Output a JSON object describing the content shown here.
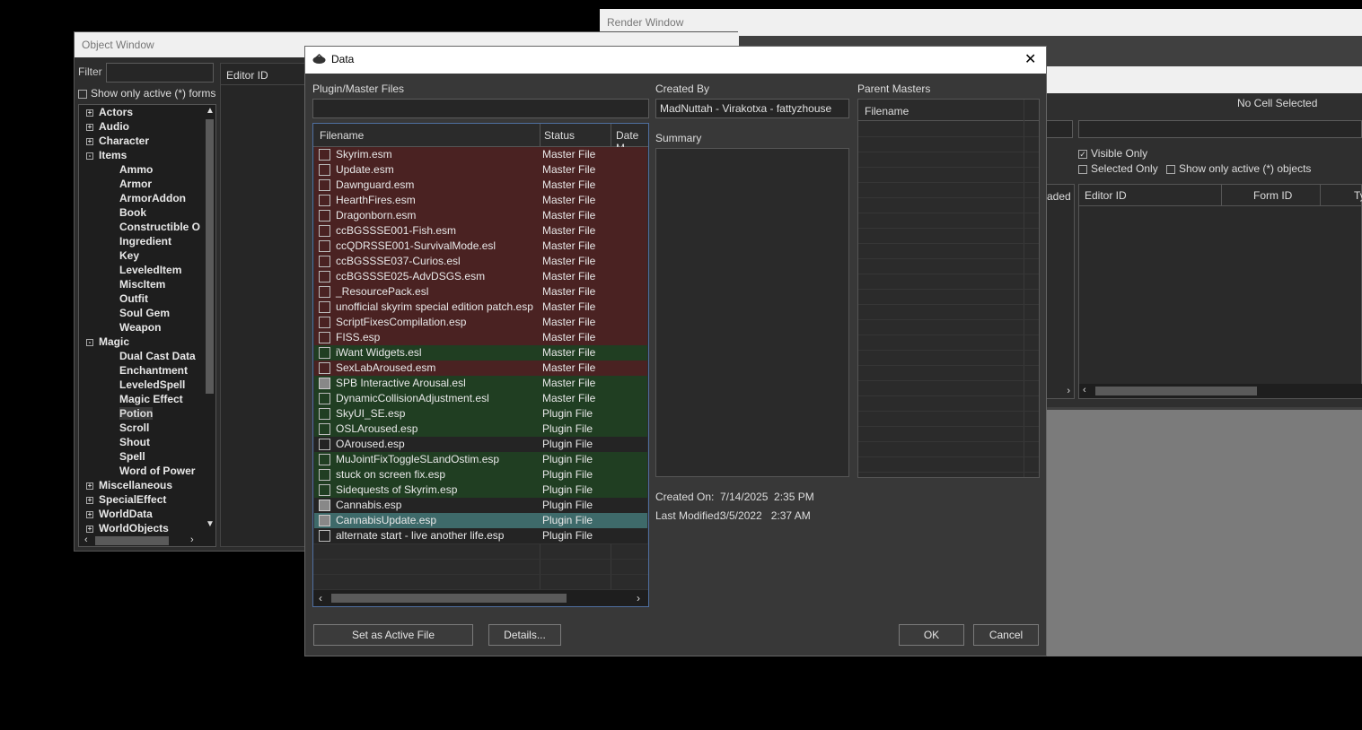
{
  "render_window": {
    "title": "Render Window",
    "no_cell": "No Cell Selected",
    "visible_only": "Visible Only",
    "selected_only": "Selected Only",
    "show_active_objects": "Show only active (*) objects",
    "col_loaded": "aded",
    "col_editor_id": "Editor ID",
    "col_form_id": "Form ID",
    "col_type": "Ty"
  },
  "object_window": {
    "title": "Object Window",
    "filter_label": "Filter",
    "show_active_forms": "Show only active (*) forms",
    "editor_id_col": "Editor ID",
    "tree": [
      {
        "label": "Actors",
        "level": 0,
        "exp": "+"
      },
      {
        "label": "Audio",
        "level": 0,
        "exp": "+"
      },
      {
        "label": "Character",
        "level": 0,
        "exp": "+"
      },
      {
        "label": "Items",
        "level": 0,
        "exp": "-"
      },
      {
        "label": "Ammo",
        "level": 1
      },
      {
        "label": "Armor",
        "level": 1
      },
      {
        "label": "ArmorAddon",
        "level": 1
      },
      {
        "label": "Book",
        "level": 1
      },
      {
        "label": "Constructible O",
        "level": 1
      },
      {
        "label": "Ingredient",
        "level": 1
      },
      {
        "label": "Key",
        "level": 1
      },
      {
        "label": "LeveledItem",
        "level": 1
      },
      {
        "label": "MiscItem",
        "level": 1
      },
      {
        "label": "Outfit",
        "level": 1
      },
      {
        "label": "Soul Gem",
        "level": 1
      },
      {
        "label": "Weapon",
        "level": 1
      },
      {
        "label": "Magic",
        "level": 0,
        "exp": "-"
      },
      {
        "label": "Dual Cast Data",
        "level": 1
      },
      {
        "label": "Enchantment",
        "level": 1
      },
      {
        "label": "LeveledSpell",
        "level": 1
      },
      {
        "label": "Magic Effect",
        "level": 1
      },
      {
        "label": "Potion",
        "level": 1,
        "selected": true
      },
      {
        "label": "Scroll",
        "level": 1
      },
      {
        "label": "Shout",
        "level": 1
      },
      {
        "label": "Spell",
        "level": 1
      },
      {
        "label": "Word of Power",
        "level": 1
      },
      {
        "label": "Miscellaneous",
        "level": 0,
        "exp": "+"
      },
      {
        "label": "SpecialEffect",
        "level": 0,
        "exp": "+"
      },
      {
        "label": "WorldData",
        "level": 0,
        "exp": "+"
      },
      {
        "label": "WorldObjects",
        "level": 0,
        "exp": "+"
      }
    ]
  },
  "dialog": {
    "title": "Data",
    "close": "✕",
    "plugin_label": "Plugin/Master Files",
    "col_filename": "Filename",
    "col_status": "Status",
    "col_date": "Date M",
    "files": [
      {
        "name": "Skyrim.esm",
        "status": "Master File",
        "color": "red",
        "checked": false
      },
      {
        "name": "Update.esm",
        "status": "Master File",
        "color": "red",
        "checked": false
      },
      {
        "name": "Dawnguard.esm",
        "status": "Master File",
        "color": "red",
        "checked": false
      },
      {
        "name": "HearthFires.esm",
        "status": "Master File",
        "color": "red",
        "checked": false
      },
      {
        "name": "Dragonborn.esm",
        "status": "Master File",
        "color": "red",
        "checked": false
      },
      {
        "name": "ccBGSSSE001-Fish.esm",
        "status": "Master File",
        "color": "red",
        "checked": false
      },
      {
        "name": "ccQDRSSE001-SurvivalMode.esl",
        "status": "Master File",
        "color": "red",
        "checked": false
      },
      {
        "name": "ccBGSSSE037-Curios.esl",
        "status": "Master File",
        "color": "red",
        "checked": false
      },
      {
        "name": "ccBGSSSE025-AdvDSGS.esm",
        "status": "Master File",
        "color": "red",
        "checked": false
      },
      {
        "name": "_ResourcePack.esl",
        "status": "Master File",
        "color": "red",
        "checked": false
      },
      {
        "name": "unofficial skyrim special edition patch.esp",
        "status": "Master File",
        "color": "red",
        "checked": false
      },
      {
        "name": "ScriptFixesCompilation.esp",
        "status": "Master File",
        "color": "red",
        "checked": false
      },
      {
        "name": "FISS.esp",
        "status": "Master File",
        "color": "red",
        "checked": false
      },
      {
        "name": "iWant Widgets.esl",
        "status": "Master File",
        "color": "green",
        "checked": false
      },
      {
        "name": "SexLabAroused.esm",
        "status": "Master File",
        "color": "red",
        "checked": false
      },
      {
        "name": "SPB Interactive Arousal.esl",
        "status": "Master File",
        "color": "green",
        "checked": true
      },
      {
        "name": "DynamicCollisionAdjustment.esl",
        "status": "Master File",
        "color": "green",
        "checked": false
      },
      {
        "name": "SkyUI_SE.esp",
        "status": "Plugin File",
        "color": "green",
        "checked": false
      },
      {
        "name": "OSLAroused.esp",
        "status": "Plugin File",
        "color": "green",
        "checked": false
      },
      {
        "name": "OAroused.esp",
        "status": "Plugin File",
        "color": "none",
        "checked": false
      },
      {
        "name": "MuJointFixToggleSLandOstim.esp",
        "status": "Plugin File",
        "color": "green",
        "checked": false
      },
      {
        "name": "stuck on screen fix.esp",
        "status": "Plugin File",
        "color": "green",
        "checked": false
      },
      {
        "name": "Sidequests of Skyrim.esp",
        "status": "Plugin File",
        "color": "green",
        "checked": false
      },
      {
        "name": "Cannabis.esp",
        "status": "Plugin File",
        "color": "none",
        "checked": true
      },
      {
        "name": "CannabisUpdate.esp",
        "status": "Plugin File",
        "color": "sel",
        "checked": true
      },
      {
        "name": "alternate start - live another life.esp",
        "status": "Plugin File",
        "color": "none",
        "checked": false
      }
    ],
    "created_by_label": "Created By",
    "created_by": "MadNuttah - Virakotxa - fattyzhouse",
    "summary_label": "Summary",
    "created_on_label": "Created On:",
    "created_on": "7/14/2025  2:35 PM",
    "last_modified_label": "Last Modified:",
    "last_modified": "3/5/2022   2:37 AM",
    "parent_masters_label": "Parent Masters",
    "pm_col_filename": "Filename",
    "set_active": "Set as Active File",
    "details": "Details...",
    "ok": "OK",
    "cancel": "Cancel"
  }
}
